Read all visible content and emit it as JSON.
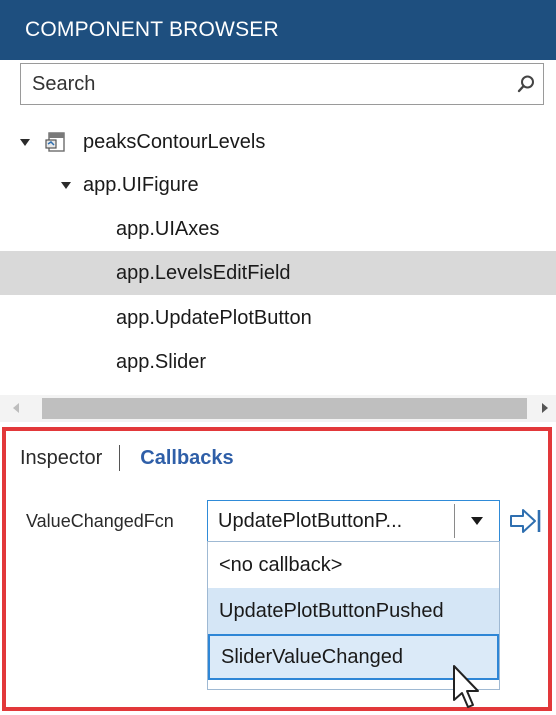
{
  "header": {
    "title": "COMPONENT BROWSER"
  },
  "search": {
    "placeholder": "Search"
  },
  "tree": {
    "root": "peaksContourLevels",
    "figure": "app.UIFigure",
    "children": [
      "app.UIAxes",
      "app.LevelsEditField",
      "app.UpdatePlotButton",
      "app.Slider"
    ],
    "selected": "app.LevelsEditField"
  },
  "inspector": {
    "tabs": {
      "inspector": "Inspector",
      "callbacks": "Callbacks"
    },
    "active_tab": "Callbacks",
    "callback_label": "ValueChangedFcn",
    "combo_value": "UpdatePlotButtonP...",
    "options": [
      "<no callback>",
      "UpdatePlotButtonPushed",
      "SliderValueChanged"
    ]
  },
  "colors": {
    "header_bg": "#1e4f7f",
    "accent": "#2f5fa8",
    "highlight_border": "#e2383a",
    "selection": "#d9d9d9"
  },
  "icons": {
    "search": "magnifier-icon",
    "app_file": "app-file-icon",
    "goto": "goto-arrow-icon"
  }
}
